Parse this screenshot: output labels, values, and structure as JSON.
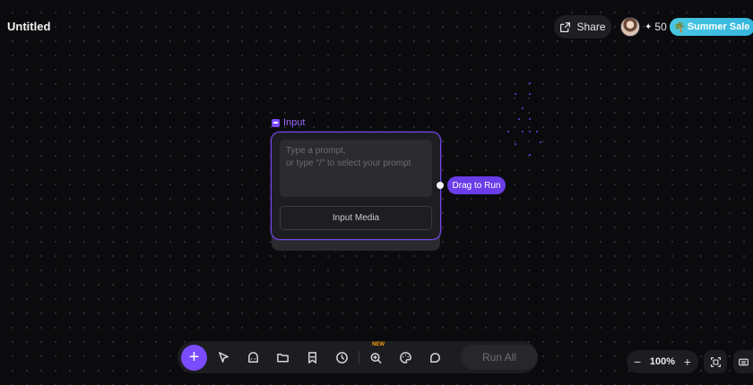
{
  "header": {
    "title": "Untitled",
    "share_label": "Share",
    "credits": "50",
    "sale_label": "Summer Sale"
  },
  "node": {
    "label": "Input",
    "prompt_placeholder": "Type a prompt,\nor type \"/\" to select your prompt",
    "input_media_label": "Input Media",
    "drag_label": "Drag to Run"
  },
  "toolbar": {
    "new_badge": "NEW",
    "run_all_label": "Run All"
  },
  "zoom": {
    "level": "100%"
  },
  "colors": {
    "accent": "#7b4bff",
    "sale": "#35b6dd",
    "background": "#0b0b0d"
  }
}
